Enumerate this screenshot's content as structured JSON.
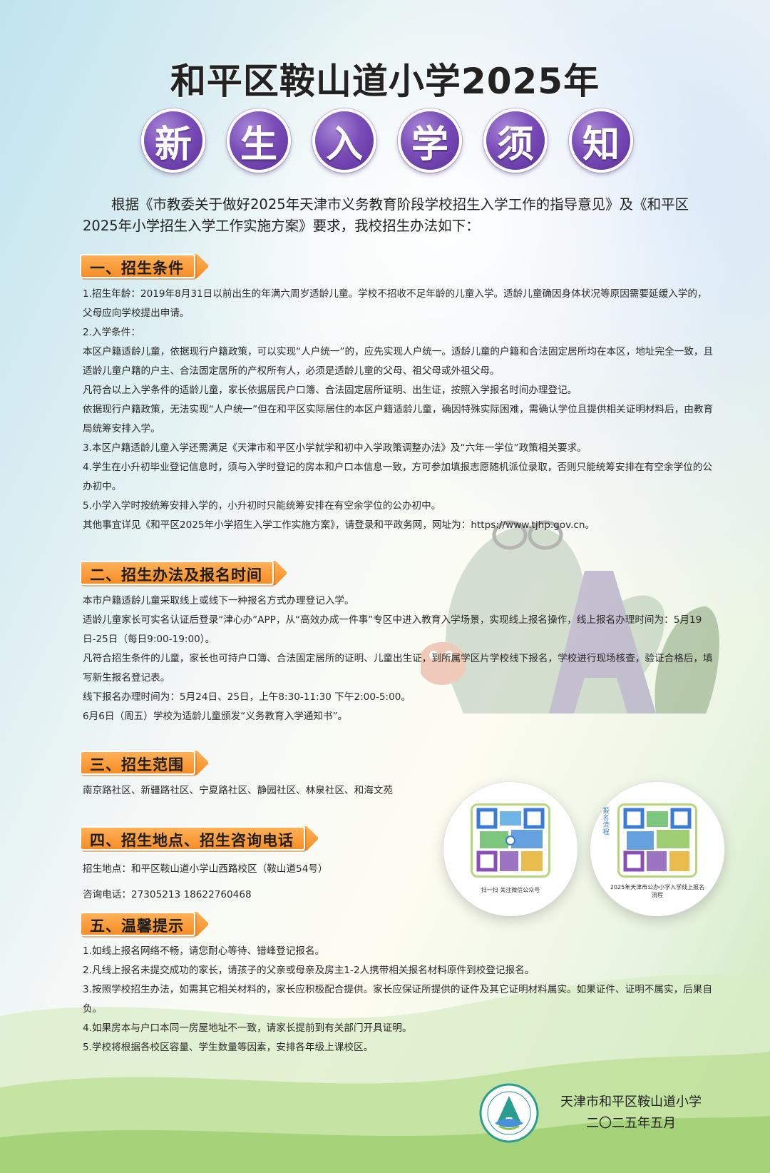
{
  "header": {
    "title": "和平区鞍山道小学2025年",
    "subtitle_chars": [
      "新",
      "生",
      "入",
      "学",
      "须",
      "知"
    ]
  },
  "intro": "根据《市教委关于做好2025年天津市义务教育阶段学校招生入学工作的指导意见》及《和平区2025年小学招生入学工作实施方案》要求，我校招生办法如下：",
  "sections": [
    {
      "heading": "一、招生条件",
      "paragraphs": [
        "1.招生年龄：2019年8月31日以前出生的年满六周岁适龄儿童。学校不招收不足年龄的儿童入学。适龄儿童确因身体状况等原因需要延缓入学的，父母应向学校提出申请。",
        "2.入学条件：",
        "本区户籍适龄儿童，依据现行户籍政策，可以实现“人户统一”的，应先实现人户统一。适龄儿童的户籍和合法固定居所均在本区，地址完全一致，且适龄儿童户籍的户主、合法固定居所的产权所有人，必须是适龄儿童的父母、祖父母或外祖父母。",
        "凡符合以上入学条件的适龄儿童，家长依据居民户口簿、合法固定居所证明、出生证，按照入学报名时间办理登记。",
        "依据现行户籍政策，无法实现“人户统一”但在和平区实际居住的本区户籍适龄儿童，确因特殊实际困难，需确认学位且提供相关证明材料后，由教育局统筹安排入学。",
        "3.本区户籍适龄儿童入学还需满足《天津市和平区小学就学和初中入学政策调整办法》及“六年一学位”政策相关要求。",
        "4.学生在小升初毕业登记信息时，须与入学时登记的房本和户口本信息一致，方可参加填报志愿随机派位录取，否则只能统筹安排在有空余学位的公办初中。",
        "5.小学入学时按统筹安排入学的，小升初时只能统筹安排在有空余学位的公办初中。",
        "其他事宜详见《和平区2025年小学招生入学工作实施方案》，请登录和平政务网，网址为：https://www.tjhp.gov.cn。"
      ]
    },
    {
      "heading": "二、招生办法及报名时间",
      "paragraphs": [
        "本市户籍适龄儿童采取线上或线下一种报名方式办理登记入学。",
        "适龄儿童家长可实名认证后登录“津心办”APP，从“高效办成一件事”专区中进入教育入学场景，实现线上报名操作，线上报名办理时间为：5月19日-25日（每日9:00-19:00）。",
        "凡符合招生条件的儿童，家长也可持户口簿、合法固定居所的证明、儿童出生证，到所属学区片学校线下报名，学校进行现场核查，验证合格后，填写新生报名登记表。",
        "线下报名办理时间为：5月24日、25日，上午8:30-11:30  下午2:00-5:00。",
        "6月6日（周五）学校为适龄儿童颁发“义务教育入学通知书”。"
      ]
    },
    {
      "heading": "三、招生范围",
      "paragraphs": [
        "南京路社区、新疆路社区、宁夏路社区、静园社区、林泉社区、和海文苑"
      ]
    },
    {
      "heading": "四、招生地点、招生咨询电话",
      "paragraphs": [
        "招生地点：和平区鞍山道小学山西路校区（鞍山道54号）",
        "咨询电话：27305213    18622760468"
      ]
    },
    {
      "heading": "五、温馨提示",
      "paragraphs": [
        "1.如线上报名网络不畅，请您耐心等待、错峰登记报名。",
        "2.凡线上报名未提交成功的家长，请孩子的父亲或母亲及房主1-2人携带相关报名材料原件到校登记报名。",
        "3.按照学校招生办法，如需其它相关材料的，家长应积极配合提供。家长应保证所提供的证件及其它证明材料属实。如果证件、证明不属实，后果自负。",
        "4.如果房本与户口本同一房屋地址不一致，请家长提前到有关部门开具证明。",
        "5.学校将根据各校区容量、学生数量等因素，安排各年级上课校区。"
      ]
    }
  ],
  "qr_codes": [
    {
      "caption": "扫一扫 关注微信公众号",
      "icon": "qr-code-icon"
    },
    {
      "side_label": "报名流程",
      "caption": "2025年天津市公办小学入学线上报名流程",
      "icon": "qr-code-icon"
    }
  ],
  "footer": {
    "school": "天津市和平区鞍山道小学",
    "date": "二〇二五年五月",
    "logo_text": "天津市和平区鞍山道小学"
  },
  "colors": {
    "title_purple": "#6b3fae",
    "section_orange": "#f68b22",
    "qr_border": "#b6d67a"
  }
}
